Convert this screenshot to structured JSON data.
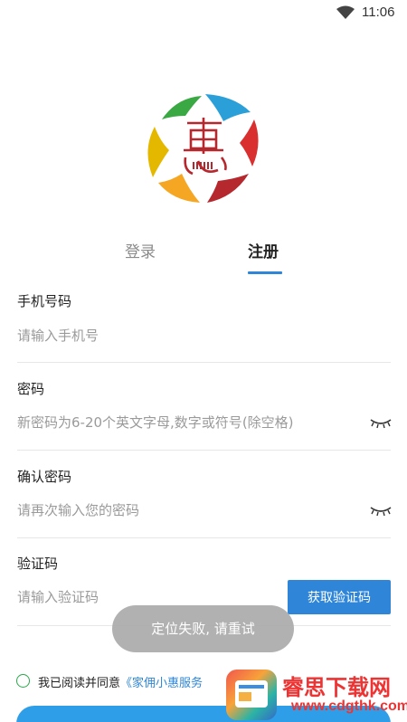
{
  "status_bar": {
    "time": "11:06",
    "wifi_icon": "wifi-icon"
  },
  "logo": {
    "icon": "hui-logo-icon",
    "colors": [
      "#f5a623",
      "#2a9fd8",
      "#d92f2f",
      "#b5282d",
      "#e5b800",
      "#3aa843"
    ]
  },
  "tabs": [
    {
      "label": "登录",
      "active": false
    },
    {
      "label": "注册",
      "active": true
    }
  ],
  "form": {
    "phone": {
      "label": "手机号码",
      "placeholder": "请输入手机号"
    },
    "password": {
      "label": "密码",
      "placeholder": "新密码为6-20个英文字母,数字或符号(除空格)",
      "eye_icon": "eye-closed-icon"
    },
    "confirm": {
      "label": "确认密码",
      "placeholder": "请再次输入您的密码",
      "eye_icon": "eye-closed-icon"
    },
    "code": {
      "label": "验证码",
      "placeholder": "请输入验证码",
      "button_label": "获取验证码"
    }
  },
  "toast": "定位失败, 请重试",
  "agreement": {
    "prefix": "我已阅读并同意",
    "link": "《家佣小惠服务"
  },
  "accent": "#2f86d9",
  "watermark": {
    "title": "睿思下载网",
    "url": "www.cdgthk.com"
  }
}
